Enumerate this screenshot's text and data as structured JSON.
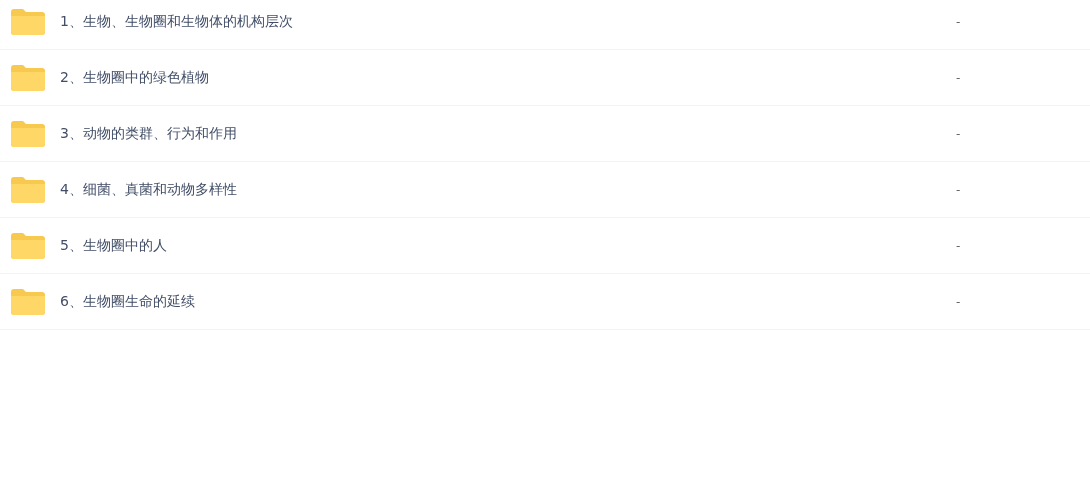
{
  "files": [
    {
      "name": "1、生物、生物圈和生物体的机构层次",
      "size": "-"
    },
    {
      "name": "2、生物圈中的绿色植物",
      "size": "-"
    },
    {
      "name": "3、动物的类群、行为和作用",
      "size": "-"
    },
    {
      "name": "4、细菌、真菌和动物多样性",
      "size": "-"
    },
    {
      "name": "5、生物圈中的人",
      "size": "-"
    },
    {
      "name": "6、生物圈生命的延续",
      "size": "-"
    }
  ]
}
